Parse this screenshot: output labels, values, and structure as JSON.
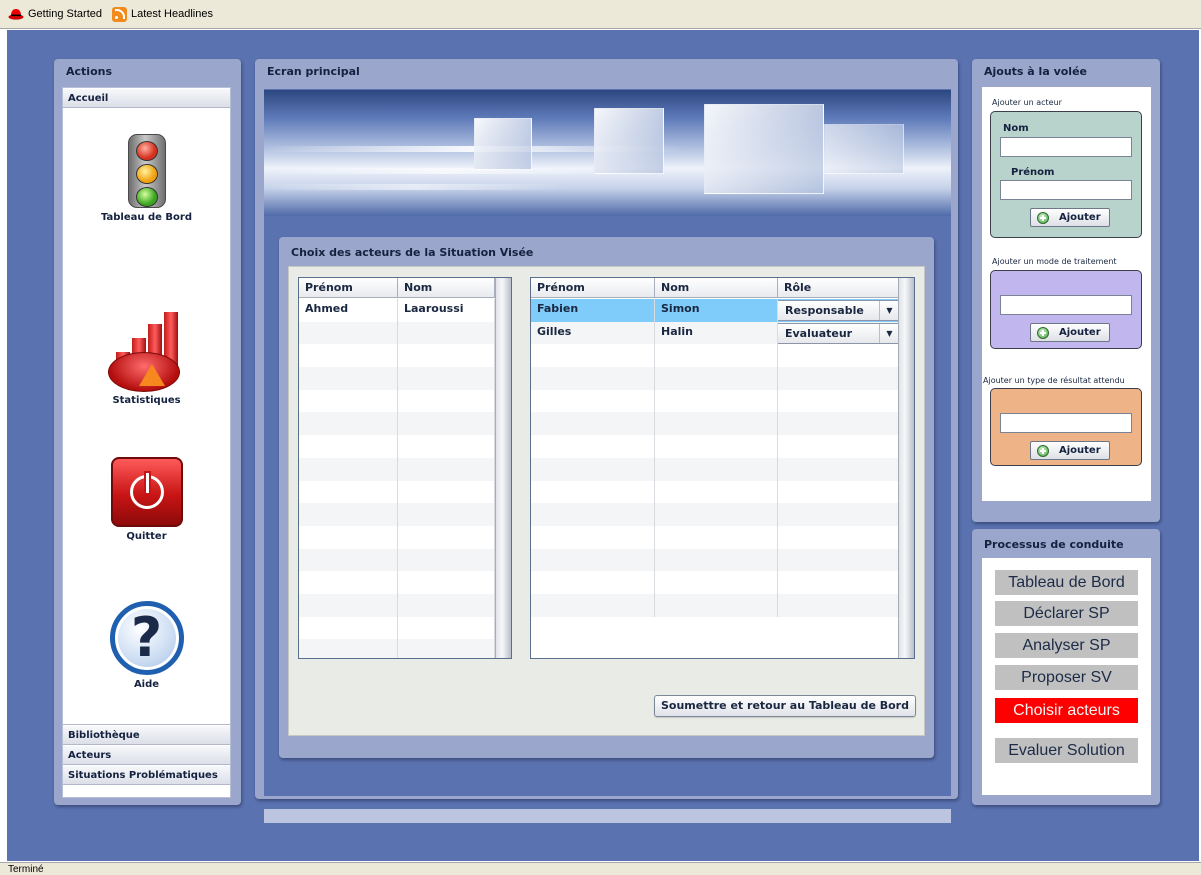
{
  "browser": {
    "bookmarks": [
      {
        "label": "Getting Started",
        "icon": "redhat-icon"
      },
      {
        "label": "Latest Headlines",
        "icon": "rss-icon"
      }
    ],
    "status": "Terminé"
  },
  "actions": {
    "title": "Actions",
    "sections": [
      "Accueil",
      "Bibliothèque",
      "Acteurs",
      "Situations Problématiques"
    ],
    "items": [
      {
        "label": "Tableau de Bord",
        "icon": "traffic-light-icon"
      },
      {
        "label": "Statistiques",
        "icon": "statistics-icon"
      },
      {
        "label": "Quitter",
        "icon": "power-icon"
      },
      {
        "label": "Aide",
        "icon": "help-icon"
      }
    ]
  },
  "main": {
    "title": "Ecran principal"
  },
  "choice": {
    "title": "Choix des acteurs de la Situation Visée",
    "available": {
      "columns": [
        "Prénom",
        "Nom"
      ],
      "rows": [
        [
          "Ahmed",
          "Laaroussi"
        ]
      ]
    },
    "selected": {
      "columns": [
        "Prénom",
        "Nom",
        "Rôle"
      ],
      "rows": [
        {
          "prenom": "Fabien",
          "nom": "Simon",
          "role": "Responsable",
          "selected": true
        },
        {
          "prenom": "Gilles",
          "nom": "Halin",
          "role": "Evaluateur",
          "selected": false
        }
      ]
    },
    "submit_label": "Soumettre et retour au Tableau de Bord"
  },
  "quick": {
    "title": "Ajouts à la volée",
    "actor": {
      "caption": "Ajouter un acteur",
      "nom_label": "Nom",
      "prenom_label": "Prénom",
      "nom_value": "",
      "prenom_value": "",
      "button": "Ajouter",
      "color": "#b8d3cc"
    },
    "treatment": {
      "caption": "Ajouter un mode de traitement",
      "value": "",
      "button": "Ajouter",
      "color": "#c2b6ee"
    },
    "result": {
      "caption": "Ajouter un type de résultat attendu",
      "value": "",
      "button": "Ajouter",
      "color": "#efb388"
    }
  },
  "process": {
    "title": "Processus de conduite",
    "steps": [
      {
        "label": "Tableau de Bord",
        "active": false
      },
      {
        "label": "Déclarer SP",
        "active": false
      },
      {
        "label": "Analyser SP",
        "active": false
      },
      {
        "label": "Proposer SV",
        "active": false
      },
      {
        "label": "Choisir acteurs",
        "active": true
      },
      {
        "label": "Evaluer Solution",
        "active": false
      }
    ],
    "active_color": "#ff0000"
  }
}
